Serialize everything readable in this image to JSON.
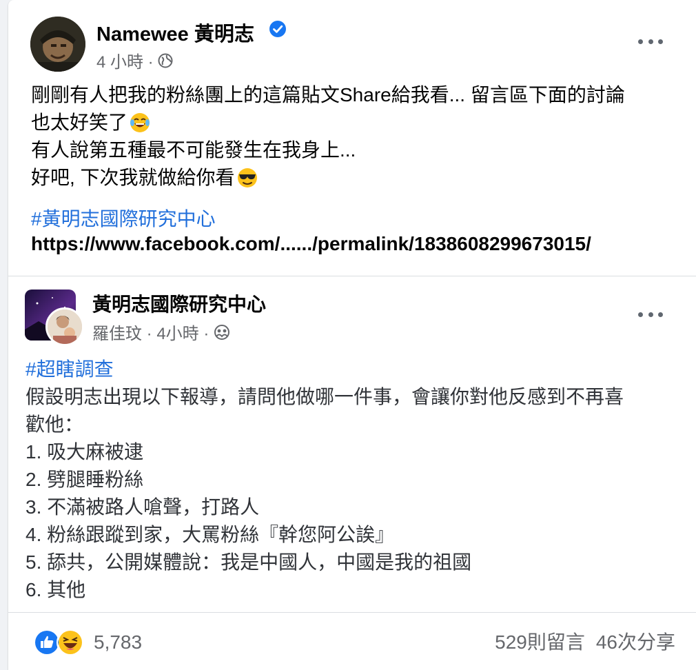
{
  "post": {
    "author_name": "Namewee 黃明志",
    "timestamp": "4 小時 ·",
    "body_lines": [
      "剛剛有人把我的粉絲團上的這篇貼文Share給我看... 留言區下面的討論",
      "也太好笑了",
      "有人說第五種最不可能發生在我身上...",
      "好吧, 下次我就做給你看"
    ],
    "hashtag": "#黃明志國際研究中心",
    "link": "https://www.facebook.com/....../permalink/1838608299673015/"
  },
  "shared_post": {
    "group_name": "黃明志國際研究中心",
    "meta": "羅佳玟 · 4小時 ·",
    "hashtag": "#超瞎調查",
    "body_lines": [
      "假設明志出現以下報導，請問他做哪一件事，會讓你對他反感到不再喜",
      "歡他：",
      "1. 吸大麻被逮",
      "2. 劈腿睡粉絲",
      "3. 不滿被路人嗆聲，打路人",
      "4. 粉絲跟蹤到家，大罵粉絲『幹您阿公誒』",
      "5. 舔共，公開媒體說：我是中國人，中國是我的祖國",
      "6. 其他"
    ]
  },
  "footer": {
    "reaction_count": "5,783",
    "comments": "529則留言",
    "shares": "46次分享"
  },
  "icons": {
    "verified": "verified-badge-icon",
    "globe": "globe-icon",
    "group": "group-privacy-icon",
    "more": "more-options-icon",
    "like": "like-reaction-icon",
    "haha": "haha-reaction-icon"
  },
  "colors": {
    "link_blue": "#216fdb",
    "secondary_text": "#65676b",
    "verified_blue": "#1877f2"
  }
}
